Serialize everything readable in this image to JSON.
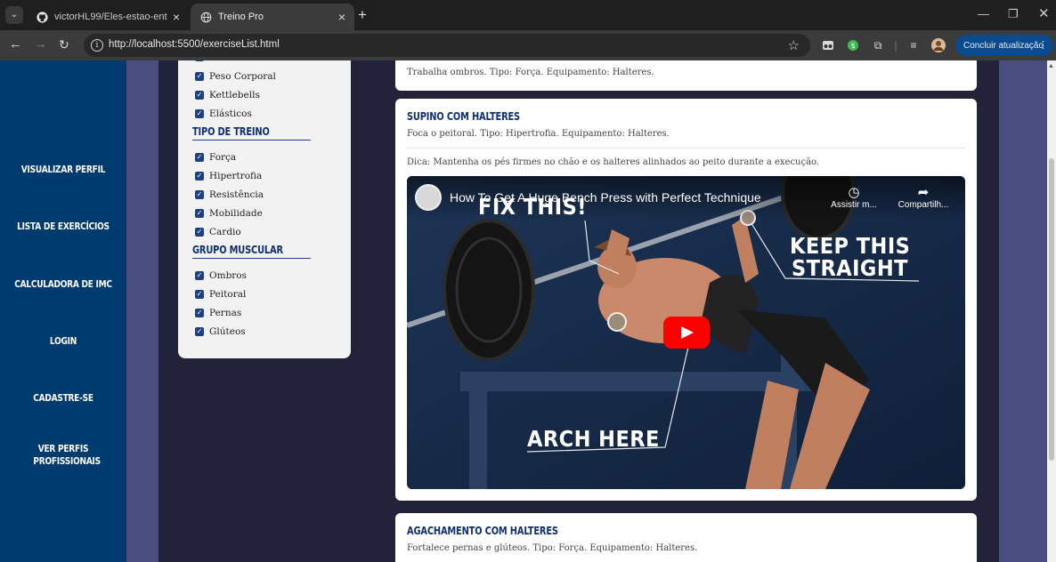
{
  "browser": {
    "tabs": [
      {
        "title": "victorHL99/Eles-estao-entre-nos",
        "active": false
      },
      {
        "title": "Treino Pro",
        "active": true
      }
    ],
    "url": "http://localhost:5500/exerciseList.html",
    "update_label": "Concluir atualização"
  },
  "sidebar": {
    "items": [
      {
        "label": "Visualizar Perfil"
      },
      {
        "label": "Lista de Exercícios"
      },
      {
        "label": "Calculadora de IMC"
      },
      {
        "label": "Login"
      },
      {
        "label": "Cadastre-se"
      },
      {
        "label": "Ver Perfis Profissionais"
      }
    ]
  },
  "filters": {
    "equipment_items": [
      "Peso Corporal",
      "Kettlebells",
      "Elásticos"
    ],
    "training_type": {
      "title": "Tipo de Treino",
      "items": [
        "Força",
        "Hipertrofia",
        "Resistência",
        "Mobilidade",
        "Cardio"
      ]
    },
    "muscle_group": {
      "title": "Grupo Muscular",
      "items": [
        "Ombros",
        "Peitoral",
        "Pernas",
        "Glúteos"
      ]
    }
  },
  "exercises": [
    {
      "description": "Trabalha ombros. Tipo: Força. Equipamento: Halteres."
    },
    {
      "title": "Supino com Halteres",
      "description": "Foca o peitoral. Tipo: Hipertrofia. Equipamento: Halteres.",
      "tip": "Dica: Mantenha os pés firmes no chão e os halteres alinhados ao peito durante a execução.",
      "video": {
        "title": "How To Get A Huge Bench Press with Perfect Technique",
        "watch_later_label": "Assistir m...",
        "share_label": "Compartilh...",
        "overlay": {
          "fix": "FIX THIS!",
          "keep": "KEEP THIS",
          "straight": "STRAIGHT",
          "arch": "ARCH HERE"
        }
      }
    },
    {
      "title": "Agachamento com Halteres",
      "description": "Fortalece pernas e glúteos. Tipo: Força. Equipamento: Halteres."
    }
  ],
  "colors": {
    "sidebar": "#003b6f",
    "background": "#22223b",
    "accent": "#0e2f73",
    "youtube_red": "#ff0000"
  }
}
